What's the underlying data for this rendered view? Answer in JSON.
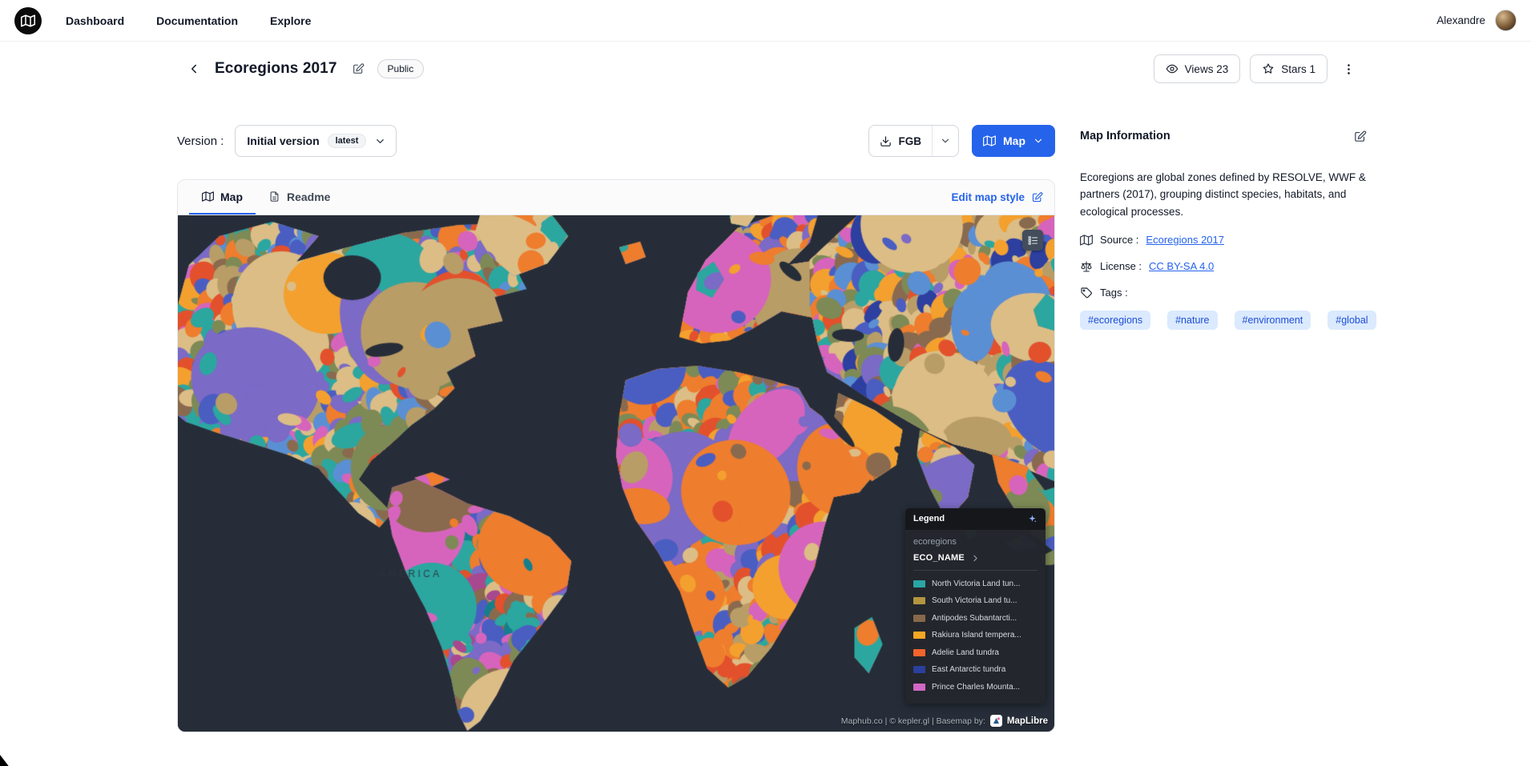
{
  "colors": {
    "accent_blue": "#2563eb",
    "tag_bg": "#dbeafe",
    "tag_text": "#1d4ed8",
    "ocean": "#262d38"
  },
  "navbar": {
    "links": [
      "Dashboard",
      "Documentation",
      "Explore"
    ],
    "user": "Alexandre"
  },
  "header": {
    "title": "Ecoregions 2017",
    "visibility_badge": "Public",
    "views_label": "Views 23",
    "stars_label": "Stars 1"
  },
  "version": {
    "label": "Version :",
    "selected": "Initial version",
    "badge": "latest"
  },
  "actions": {
    "download_label": "FGB",
    "map_button_label": "Map"
  },
  "tabs": {
    "map": "Map",
    "readme": "Readme"
  },
  "edit_map_style_label": "Edit map style",
  "map": {
    "watermark": "AMERICA",
    "attribution": "Maphub.co  | © kepler.gl | Basemap by:",
    "maplibre_label": "MapLibre",
    "ocean_color": "#262d38",
    "palette": [
      "#2ba7a0",
      "#157f8d",
      "#ee7d2e",
      "#e2512c",
      "#f3a02f",
      "#7b6ac6",
      "#4a5ec2",
      "#2d3f9f",
      "#dcbd86",
      "#b99d67",
      "#8a6a4e",
      "#d664bd",
      "#a8498f",
      "#7d8a56",
      "#5b8fd4",
      "#bf5a4e"
    ],
    "legend": {
      "title": "Legend",
      "layer_name": "ecoregions",
      "field_name": "ECO_NAME",
      "items": [
        {
          "color": "#29a5a5",
          "label": "North Victoria Land tun..."
        },
        {
          "color": "#b3953f",
          "label": "South Victoria Land tu..."
        },
        {
          "color": "#87684a",
          "label": "Antipodes Subantarcti..."
        },
        {
          "color": "#f5a623",
          "label": "Rakiura Island tempera..."
        },
        {
          "color": "#f4642d",
          "label": "Adelie Land tundra"
        },
        {
          "color": "#2b3f9e",
          "label": "East Antarctic tundra"
        },
        {
          "color": "#d167c5",
          "label": "Prince Charles Mounta..."
        }
      ]
    }
  },
  "sidebar": {
    "title": "Map Information",
    "description": "Ecoregions are global zones defined by RESOLVE, WWF & partners (2017), grouping distinct species, habitats, and ecological processes.",
    "source_label": "Source :",
    "source_link": "Ecoregions 2017",
    "license_label": "License :",
    "license_link": "CC BY-SA 4.0",
    "tags_label": "Tags :",
    "tags": [
      "#ecoregions",
      "#nature",
      "#environment",
      "#global"
    ]
  }
}
